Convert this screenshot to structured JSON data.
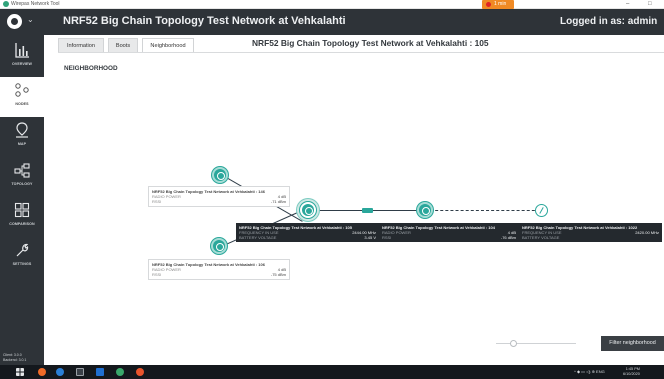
{
  "window": {
    "title": "Wirepas Network Tool",
    "recording_label": "1 min",
    "minimize": "–",
    "restore": "□"
  },
  "header": {
    "title": "NRF52 Big Chain Topology Test Network at Vehkalahti",
    "login_text": "Logged in as: admin"
  },
  "sidebar": {
    "items": [
      {
        "label": "OVERVIEW",
        "icon": "bar-chart-icon"
      },
      {
        "label": "NODES",
        "icon": "nodes-icon"
      },
      {
        "label": "MAP",
        "icon": "map-icon"
      },
      {
        "label": "TOPOLOGY",
        "icon": "topology-icon"
      },
      {
        "label": "COMPARISON",
        "icon": "comparison-icon"
      },
      {
        "label": "SETTINGS",
        "icon": "wrench-icon"
      }
    ],
    "version_text": "Client: 3.0.0\nBackend: 3.0.1"
  },
  "tabs": [
    {
      "label": "Information"
    },
    {
      "label": "Boots"
    },
    {
      "label": "Neighborhood"
    }
  ],
  "page_title": "NRF52 Big Chain Topology Test Network at Vehkalahti : 105",
  "section_title": "NEIGHBORHOOD",
  "graph": {
    "badge_color": "#2aa79b",
    "cards": [
      {
        "title": "NRF52 Big Chain Topology Test Network at Vehkalahti : 146",
        "rows": [
          [
            "RADIO POWER",
            "4 dB"
          ],
          [
            "RSSI",
            "-71 dBm"
          ]
        ]
      },
      {
        "title": "NRF52 Big Chain Topology Test Network at Vehkalahti : 105",
        "rows": [
          [
            "FREQUENCY IN USE",
            "2444.00 MHz"
          ],
          [
            "BATTERY VOLTAGE",
            "3.45 V"
          ]
        ]
      },
      {
        "title": "NRF52 Big Chain Topology Test Network at Vehkalahti : 104",
        "rows": [
          [
            "RADIO POWER",
            "4 dB"
          ],
          [
            "RSSI",
            "-76 dBm"
          ]
        ]
      },
      {
        "title": "NRF52 Big Chain Topology Test Network at Vehkalahti : 1022",
        "rows": [
          [
            "FREQUENCY IN USE",
            "2420.00 MHz"
          ],
          [
            "BATTERY VOLTAGE",
            ""
          ]
        ]
      },
      {
        "title": "NRF52 Big Chain Topology Test Network at Vehkalahti : 106",
        "rows": [
          [
            "RADIO POWER",
            "4 dB"
          ],
          [
            "RSSI",
            "-75 dBm"
          ]
        ]
      }
    ]
  },
  "filter_button": "Filter neighborhood",
  "taskbar": {
    "tray_text": "^ ◆ ▭ ◁) ⊕ ENG",
    "clock": "1:45 PM\n6/10/2020"
  },
  "colors": {
    "header_bg": "#2e3338",
    "accent_teal": "#2aa79b",
    "dark_card": "#24292e"
  }
}
